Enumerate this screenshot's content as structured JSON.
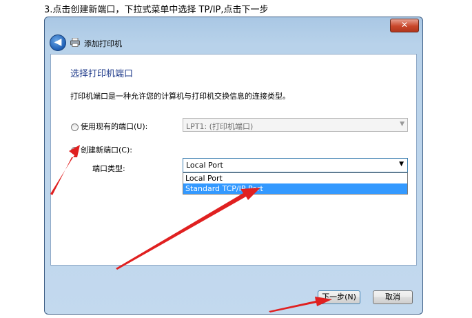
{
  "instruction": "3.点击创建新端口，下拉式菜单中选择 TP/IP,点击下一步",
  "window": {
    "close_symbol": "✕",
    "back_symbol": "◀",
    "title": "添加打印机"
  },
  "page": {
    "heading": "选择打印机端口",
    "description": "打印机端口是一种允许您的计算机与打印机交换信息的连接类型。",
    "use_existing_label": "使用现有的端口(U):",
    "existing_port_value": "LPT1: (打印机端口)",
    "create_new_label": "创建新端口(C):",
    "port_type_label": "端口类型:",
    "port_type_value": "Local Port",
    "port_options": [
      "Local Port",
      "Standard TCP/IP Port"
    ],
    "selected_option": "Standard TCP/IP Port"
  },
  "buttons": {
    "next": "下一步(N)",
    "cancel": "取消"
  },
  "colors": {
    "annotation_arrow": "#e02020",
    "selection": "#3399ff",
    "heading": "#1e3a8a"
  }
}
